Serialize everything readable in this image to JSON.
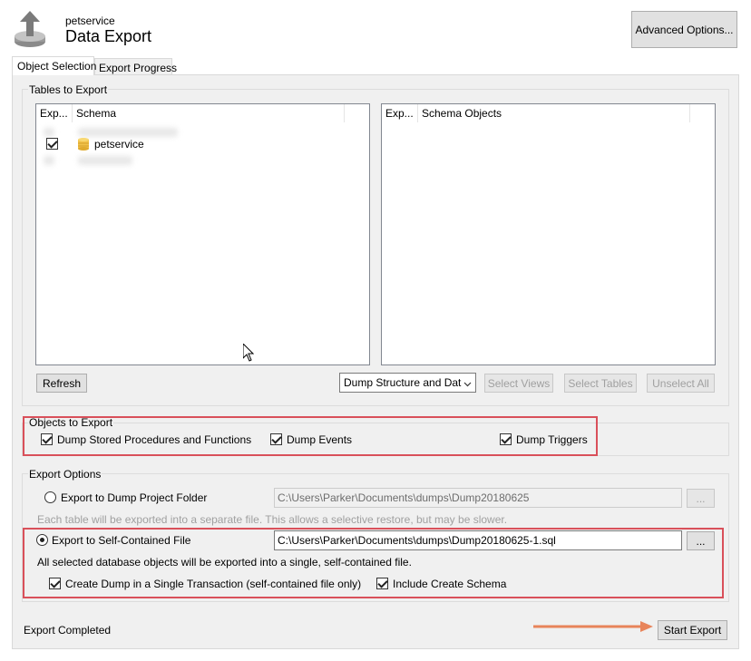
{
  "header": {
    "subtitle": "petservice",
    "title": "Data Export",
    "advanced_button": "Advanced Options..."
  },
  "tabs": [
    {
      "label": "Object Selection",
      "active": true
    },
    {
      "label": "Export Progress",
      "active": false
    }
  ],
  "tables_to_export": {
    "title": "Tables to Export",
    "left_list": {
      "col_export": "Exp...",
      "col_schema": "Schema",
      "rows": [
        {
          "checked": false,
          "label": ""
        },
        {
          "checked": true,
          "label": "petservice"
        },
        {
          "checked": false,
          "label": ""
        }
      ]
    },
    "right_list": {
      "col_export": "Exp...",
      "col_objects": "Schema Objects"
    },
    "refresh_button": "Refresh",
    "dump_select": "Dump Structure and Dat",
    "select_views": "Select Views",
    "select_tables": "Select Tables",
    "unselect_all": "Unselect All"
  },
  "objects_to_export": {
    "title": "Objects to Export",
    "items": [
      {
        "label": "Dump Stored Procedures and Functions",
        "checked": true
      },
      {
        "label": "Dump Events",
        "checked": true
      },
      {
        "label": "Dump Triggers",
        "checked": true
      }
    ]
  },
  "export_options": {
    "title": "Export Options",
    "folder_option": "Export to Dump Project Folder",
    "folder_path": "C:\\Users\\Parker\\Documents\\dumps\\Dump20180625",
    "folder_hint": "Each table will be exported into a separate file. This allows a selective restore, but may be slower.",
    "file_option": "Export to Self-Contained File",
    "file_path": "C:\\Users\\Parker\\Documents\\dumps\\Dump20180625-1.sql",
    "file_hint": "All selected database objects will be exported into a single, self-contained file.",
    "browse": "...",
    "single_transaction": "Create Dump in a Single Transaction (self-contained file only)",
    "include_schema": "Include Create Schema"
  },
  "footer": {
    "status": "Export Completed",
    "start_button": "Start Export"
  },
  "colors": {
    "highlight": "#d9505a",
    "arrow": "#e8845a",
    "panel": "#f0f0f0"
  }
}
